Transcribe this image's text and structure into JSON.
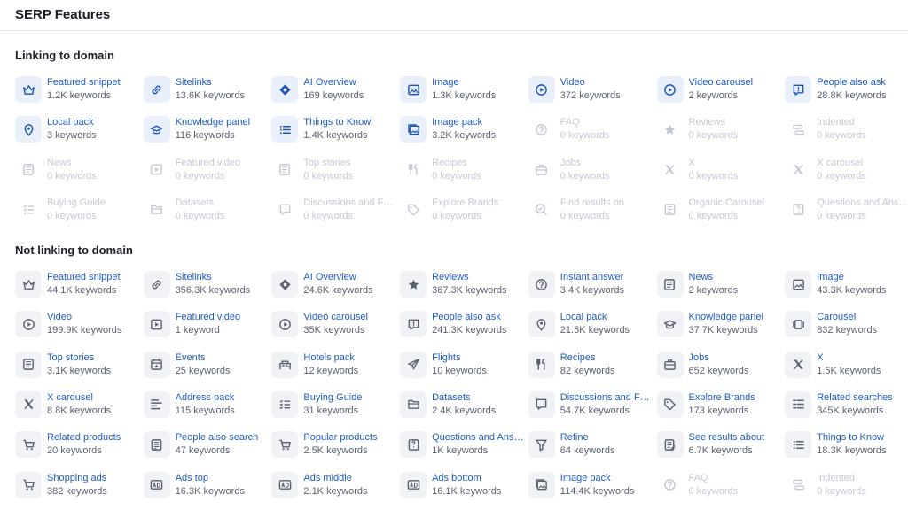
{
  "header": {
    "title": "SERP Features"
  },
  "linking": {
    "title": "Linking to domain",
    "items": [
      {
        "label": "Featured snippet",
        "count": "1.2K keywords",
        "icon": "crown-icon",
        "state": "active"
      },
      {
        "label": "Sitelinks",
        "count": "13.6K keywords",
        "icon": "link-icon",
        "state": "active"
      },
      {
        "label": "AI Overview",
        "count": "169 keywords",
        "icon": "ai-sparkle-icon",
        "state": "active"
      },
      {
        "label": "Image",
        "count": "1.3K keywords",
        "icon": "image-icon",
        "state": "active"
      },
      {
        "label": "Video",
        "count": "372 keywords",
        "icon": "play-icon",
        "state": "active"
      },
      {
        "label": "Video carousel",
        "count": "2 keywords",
        "icon": "play-icon",
        "state": "active"
      },
      {
        "label": "People also ask",
        "count": "28.8K keywords",
        "icon": "question-bubble-icon",
        "state": "active"
      },
      {
        "label": "Local pack",
        "count": "3 keywords",
        "icon": "pin-icon",
        "state": "active"
      },
      {
        "label": "Knowledge panel",
        "count": "116 keywords",
        "icon": "graduation-cap-icon",
        "state": "active"
      },
      {
        "label": "Things to Know",
        "count": "1.4K keywords",
        "icon": "list-icon",
        "state": "active"
      },
      {
        "label": "Image pack",
        "count": "3.2K keywords",
        "icon": "image-pack-icon",
        "state": "active"
      },
      {
        "label": "FAQ",
        "count": "0 keywords",
        "icon": "question-circle-icon",
        "state": "inactive"
      },
      {
        "label": "Reviews",
        "count": "0 keywords",
        "icon": "star-icon",
        "state": "inactive"
      },
      {
        "label": "Indented",
        "count": "0 keywords",
        "icon": "indented-icon",
        "state": "inactive"
      },
      {
        "label": "News",
        "count": "0 keywords",
        "icon": "news-icon",
        "state": "inactive"
      },
      {
        "label": "Featured video",
        "count": "0 keywords",
        "icon": "video-frame-icon",
        "state": "inactive"
      },
      {
        "label": "Top stories",
        "count": "0 keywords",
        "icon": "news-icon",
        "state": "inactive"
      },
      {
        "label": "Recipes",
        "count": "0 keywords",
        "icon": "fork-knife-icon",
        "state": "inactive"
      },
      {
        "label": "Jobs",
        "count": "0 keywords",
        "icon": "briefcase-icon",
        "state": "inactive"
      },
      {
        "label": "X",
        "count": "0 keywords",
        "icon": "x-logo-icon",
        "state": "inactive"
      },
      {
        "label": "X carousel",
        "count": "0 keywords",
        "icon": "x-logo-icon",
        "state": "inactive"
      },
      {
        "label": "Buying Guide",
        "count": "0 keywords",
        "icon": "checklist-icon",
        "state": "inactive"
      },
      {
        "label": "Datasets",
        "count": "0 keywords",
        "icon": "folder-icon",
        "state": "inactive"
      },
      {
        "label": "Discussions and Forums",
        "count": "0 keywords",
        "icon": "chat-icon",
        "state": "inactive"
      },
      {
        "label": "Explore Brands",
        "count": "0 keywords",
        "icon": "tag-icon",
        "state": "inactive"
      },
      {
        "label": "Find results on",
        "count": "0 keywords",
        "icon": "search-check-icon",
        "state": "inactive"
      },
      {
        "label": "Organic Carousel",
        "count": "0 keywords",
        "icon": "document-icon",
        "state": "inactive"
      },
      {
        "label": "Questions and Answers",
        "count": "0 keywords",
        "icon": "qa-icon",
        "state": "inactive"
      }
    ]
  },
  "not_linking": {
    "title": "Not linking to domain",
    "items": [
      {
        "label": "Featured snippet",
        "count": "44.1K keywords",
        "icon": "crown-icon",
        "state": "neutral"
      },
      {
        "label": "Sitelinks",
        "count": "356.3K keywords",
        "icon": "link-icon",
        "state": "neutral"
      },
      {
        "label": "AI Overview",
        "count": "24.6K keywords",
        "icon": "ai-sparkle-icon",
        "state": "neutral"
      },
      {
        "label": "Reviews",
        "count": "367.3K keywords",
        "icon": "star-icon",
        "state": "neutral"
      },
      {
        "label": "Instant answer",
        "count": "3.4K keywords",
        "icon": "question-circle-icon",
        "state": "neutral"
      },
      {
        "label": "News",
        "count": "2 keywords",
        "icon": "news-icon",
        "state": "neutral"
      },
      {
        "label": "Image",
        "count": "43.3K keywords",
        "icon": "image-icon",
        "state": "neutral"
      },
      {
        "label": "Video",
        "count": "199.9K keywords",
        "icon": "play-icon",
        "state": "neutral"
      },
      {
        "label": "Featured video",
        "count": "1 keyword",
        "icon": "video-frame-icon",
        "state": "neutral"
      },
      {
        "label": "Video carousel",
        "count": "35K keywords",
        "icon": "play-icon",
        "state": "neutral"
      },
      {
        "label": "People also ask",
        "count": "241.3K keywords",
        "icon": "question-bubble-icon",
        "state": "neutral"
      },
      {
        "label": "Local pack",
        "count": "21.5K keywords",
        "icon": "pin-icon",
        "state": "neutral"
      },
      {
        "label": "Knowledge panel",
        "count": "37.7K keywords",
        "icon": "graduation-cap-icon",
        "state": "neutral"
      },
      {
        "label": "Carousel",
        "count": "832 keywords",
        "icon": "carousel-icon",
        "state": "neutral"
      },
      {
        "label": "Top stories",
        "count": "3.1K keywords",
        "icon": "news-icon",
        "state": "neutral"
      },
      {
        "label": "Events",
        "count": "25 keywords",
        "icon": "calendar-icon",
        "state": "neutral"
      },
      {
        "label": "Hotels pack",
        "count": "12 keywords",
        "icon": "hotel-icon",
        "state": "neutral"
      },
      {
        "label": "Flights",
        "count": "10 keywords",
        "icon": "plane-icon",
        "state": "neutral"
      },
      {
        "label": "Recipes",
        "count": "82 keywords",
        "icon": "fork-knife-icon",
        "state": "neutral"
      },
      {
        "label": "Jobs",
        "count": "652 keywords",
        "icon": "briefcase-icon",
        "state": "neutral"
      },
      {
        "label": "X",
        "count": "1.5K keywords",
        "icon": "x-logo-icon",
        "state": "neutral"
      },
      {
        "label": "X carousel",
        "count": "8.8K keywords",
        "icon": "x-logo-icon",
        "state": "neutral"
      },
      {
        "label": "Address pack",
        "count": "115 keywords",
        "icon": "address-icon",
        "state": "neutral"
      },
      {
        "label": "Buying Guide",
        "count": "31 keywords",
        "icon": "checklist-icon",
        "state": "neutral"
      },
      {
        "label": "Datasets",
        "count": "2.4K keywords",
        "icon": "folder-icon",
        "state": "neutral"
      },
      {
        "label": "Discussions and Forums",
        "count": "54.7K keywords",
        "icon": "chat-icon",
        "state": "neutral"
      },
      {
        "label": "Explore Brands",
        "count": "173 keywords",
        "icon": "tag-icon",
        "state": "neutral"
      },
      {
        "label": "Related searches",
        "count": "345K keywords",
        "icon": "grid-list-icon",
        "state": "neutral"
      },
      {
        "label": "Related products",
        "count": "20 keywords",
        "icon": "cart-icon",
        "state": "neutral"
      },
      {
        "label": "People also search",
        "count": "47 keywords",
        "icon": "document-list-icon",
        "state": "neutral"
      },
      {
        "label": "Popular products",
        "count": "2.5K keywords",
        "icon": "cart-icon",
        "state": "neutral"
      },
      {
        "label": "Questions and Answers",
        "count": "1K keywords",
        "icon": "qa-icon",
        "state": "neutral"
      },
      {
        "label": "Refine",
        "count": "64 keywords",
        "icon": "filter-icon",
        "state": "neutral"
      },
      {
        "label": "See results about",
        "count": "6.7K keywords",
        "icon": "document-edit-icon",
        "state": "neutral"
      },
      {
        "label": "Things to Know",
        "count": "18.3K keywords",
        "icon": "list-icon",
        "state": "neutral"
      },
      {
        "label": "Shopping ads",
        "count": "382 keywords",
        "icon": "cart-icon",
        "state": "neutral"
      },
      {
        "label": "Ads top",
        "count": "16.3K keywords",
        "icon": "ad-icon",
        "state": "neutral"
      },
      {
        "label": "Ads middle",
        "count": "2.1K keywords",
        "icon": "ad-icon",
        "state": "neutral"
      },
      {
        "label": "Ads bottom",
        "count": "16.1K keywords",
        "icon": "ad-icon",
        "state": "neutral"
      },
      {
        "label": "Image pack",
        "count": "114.4K keywords",
        "icon": "image-pack-icon",
        "state": "neutral"
      },
      {
        "label": "FAQ",
        "count": "0 keywords",
        "icon": "question-circle-icon",
        "state": "inactive"
      },
      {
        "label": "Indented",
        "count": "0 keywords",
        "icon": "indented-icon",
        "state": "inactive"
      }
    ]
  }
}
